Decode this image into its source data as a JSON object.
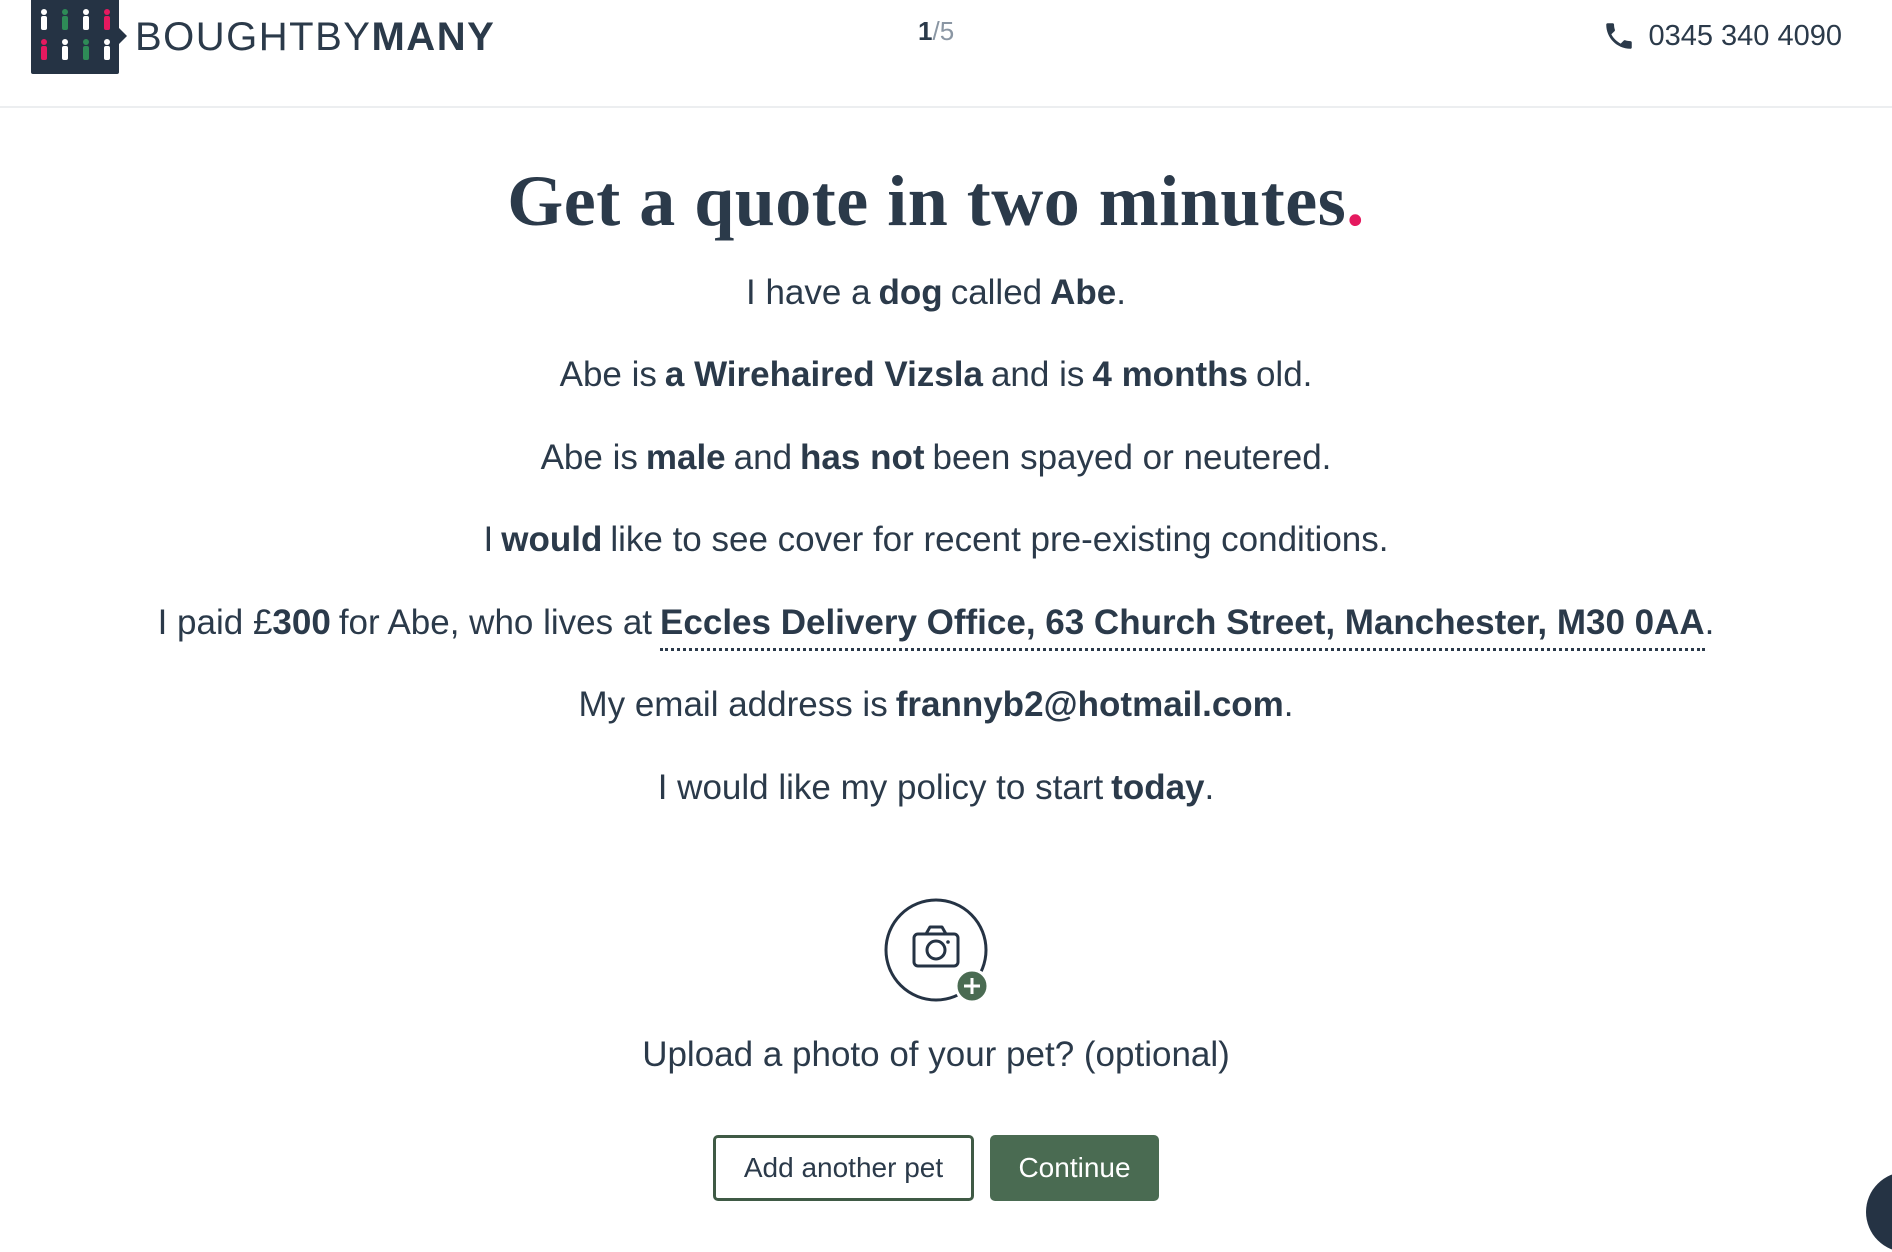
{
  "header": {
    "brand_light": "BOUGHTBY",
    "brand_bold": "MANY",
    "progress_current": "1",
    "progress_total": "/5",
    "phone": "0345 340 4090",
    "logo_colors": [
      "#2e8b57",
      "#e5195f",
      "#ffffff"
    ]
  },
  "main": {
    "title": "Get a quote in two minutes",
    "title_dot": ".",
    "line1": {
      "a": "I have a",
      "pet_type": "dog",
      "b": "called",
      "pet_name": "Abe",
      "end": "."
    },
    "line2": {
      "a": "Abe is",
      "breed": "a Wirehaired Vizsla",
      "b": "and is",
      "age": "4 months",
      "end": "old."
    },
    "line3": {
      "a": "Abe is",
      "sex": "male",
      "b": "and",
      "neutered": "has not",
      "end": "been spayed or neutered."
    },
    "line4": {
      "a": "I",
      "cover": "would",
      "end": "like to see cover for recent pre-existing conditions."
    },
    "line5": {
      "a": "I paid £",
      "price": "300",
      "b": "for Abe, who lives at",
      "address": "Eccles Delivery Office, 63 Church Street, Manchester, M30 0AA",
      "end": "."
    },
    "line6": {
      "a": "My email address is",
      "email": "frannyb2@hotmail.com",
      "end": "."
    },
    "line7": {
      "a": "I would like my policy to start",
      "start": "today",
      "end": "."
    },
    "upload_text": "Upload a photo of your pet? (optional)",
    "add_pet_label": "Add another pet",
    "continue_label": "Continue"
  },
  "colors": {
    "text": "#2b3a4a",
    "accent_dot": "#e5195f",
    "primary_button": "#4a6b52",
    "navy": "#253344"
  },
  "icons": [
    "phone-icon",
    "camera-add-icon",
    "plus-icon"
  ]
}
